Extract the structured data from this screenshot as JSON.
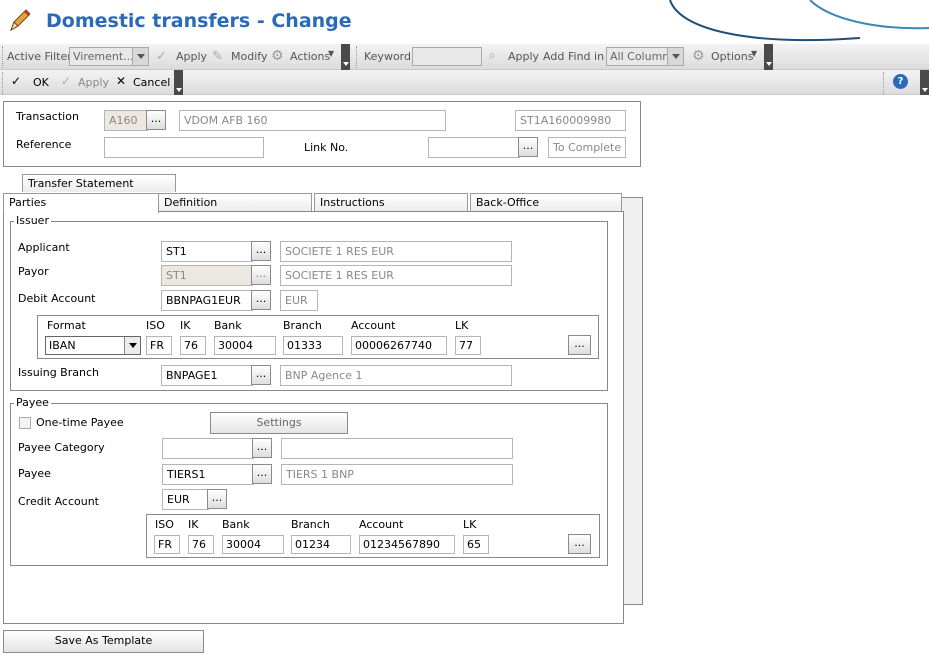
{
  "window": {
    "title": "Domestic transfers - Change"
  },
  "toolbar1": {
    "active_filter_label": "Active Filter",
    "active_filter_value": "Virement...",
    "apply": "Apply",
    "modify": "Modify",
    "actions": "Actions",
    "keyword_label": "Keyword",
    "keyword_value": "",
    "apply2": "Apply",
    "add": "Add",
    "find_in_label": "Find in",
    "find_in_value": "All Columns",
    "options": "Options"
  },
  "toolbar2": {
    "ok": "OK",
    "apply": "Apply",
    "cancel": "Cancel"
  },
  "header": {
    "transaction_label": "Transaction",
    "transaction_code": "A160",
    "transaction_desc": "VDOM AFB 160",
    "transaction_id": "ST1A160009980",
    "reference_label": "Reference",
    "reference_value": "",
    "link_no_label": "Link No.",
    "link_no_value": "",
    "status": "To Complete",
    "dots": "..."
  },
  "tabs": {
    "transfer_statement": "Transfer Statement",
    "parties": "Parties",
    "definition": "Definition",
    "instructions": "Instructions",
    "back_office": "Back-Office"
  },
  "issuer": {
    "legend": "Issuer",
    "applicant_label": "Applicant",
    "applicant_code": "ST1",
    "applicant_name": "SOCIETE 1 RES EUR",
    "payor_label": "Payor",
    "payor_code": "ST1",
    "payor_name": "SOCIETE 1 RES EUR",
    "debit_account_label": "Debit Account",
    "debit_account_code": "BBNPAG1EUR",
    "debit_account_currency": "EUR",
    "format_label": "Format",
    "format_value": "IBAN",
    "iso_label": "ISO",
    "iso_value": "FR",
    "ik_label": "IK",
    "ik_value": "76",
    "bank_label": "Bank",
    "bank_value": "30004",
    "branch_label": "Branch",
    "branch_value": "01333",
    "account_label": "Account",
    "account_value": "00006267740",
    "lk_label": "LK",
    "lk_value": "77",
    "issuing_branch_label": "Issuing Branch",
    "issuing_branch_code": "BNPAGE1",
    "issuing_branch_name": "BNP Agence 1"
  },
  "payee": {
    "legend": "Payee",
    "one_time_label": "One-time Payee",
    "settings": "Settings",
    "category_label": "Payee Category",
    "category_code": "",
    "category_name": "",
    "payee_label": "Payee",
    "payee_code": "TIERS1",
    "payee_name": "TIERS 1 BNP",
    "credit_account_label": "Credit Account",
    "credit_account_value": "EUR",
    "iso_label": "ISO",
    "iso_value": "FR",
    "ik_label": "IK",
    "ik_value": "76",
    "bank_label": "Bank",
    "bank_value": "30004",
    "branch_label": "Branch",
    "branch_value": "01234",
    "account_label": "Account",
    "account_value": "01234567890",
    "lk_label": "LK",
    "lk_value": "65"
  },
  "footer": {
    "save_template": "Save As Template"
  },
  "colors": {
    "title": "#2a6ab8",
    "readonly_bg": "#ede7e2"
  }
}
